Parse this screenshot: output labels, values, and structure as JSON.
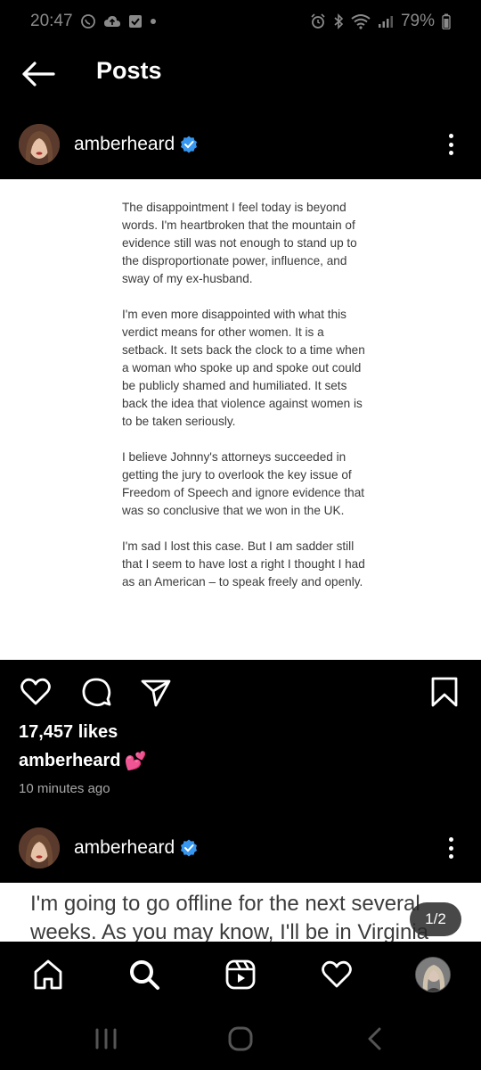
{
  "status_bar": {
    "time": "20:47",
    "battery": "79%"
  },
  "header": {
    "title": "Posts"
  },
  "posts": [
    {
      "username": "amberheard",
      "text_paragraphs": [
        "The disappointment I feel today is beyond words. I'm heartbroken that the mountain of evidence still was not enough to stand up to the disproportionate power, influence, and sway of my ex-husband.",
        "I'm even more disappointed with what this verdict means for other women. It is a setback. It sets back the clock to a time when a woman who spoke up and spoke out could be publicly shamed and humiliated. It sets back the idea that violence against women is to be taken seriously.",
        "I believe Johnny's attorneys succeeded in getting the jury to overlook the key issue of Freedom of Speech and ignore evidence that was so conclusive that we won in the UK.",
        "I'm sad I lost this case. But I am sadder still that I seem to have lost a right I thought I had as an American – to speak freely and openly."
      ],
      "likes": "17,457 likes",
      "caption_user": "amberheard",
      "caption_emoji": "💕",
      "time_ago": "10 minutes ago"
    },
    {
      "username": "amberheard",
      "text_preview": "I'm going to go offline for the next several weeks. As you may know, I'll be in Virginia",
      "page_counter": "1/2"
    }
  ],
  "icons": {
    "back": "back-arrow-icon",
    "verified": "verified-badge-icon",
    "more": "more-vertical-icon",
    "like": "heart-icon",
    "comment": "comment-icon",
    "share": "send-icon",
    "save": "bookmark-icon",
    "home": "home-icon",
    "search": "search-icon",
    "reels": "reels-icon",
    "activity": "heart-icon",
    "profile": "profile-avatar"
  },
  "colors": {
    "verified_blue": "#3797f0",
    "background": "#000000",
    "secondary_text": "#a8a8a8"
  }
}
